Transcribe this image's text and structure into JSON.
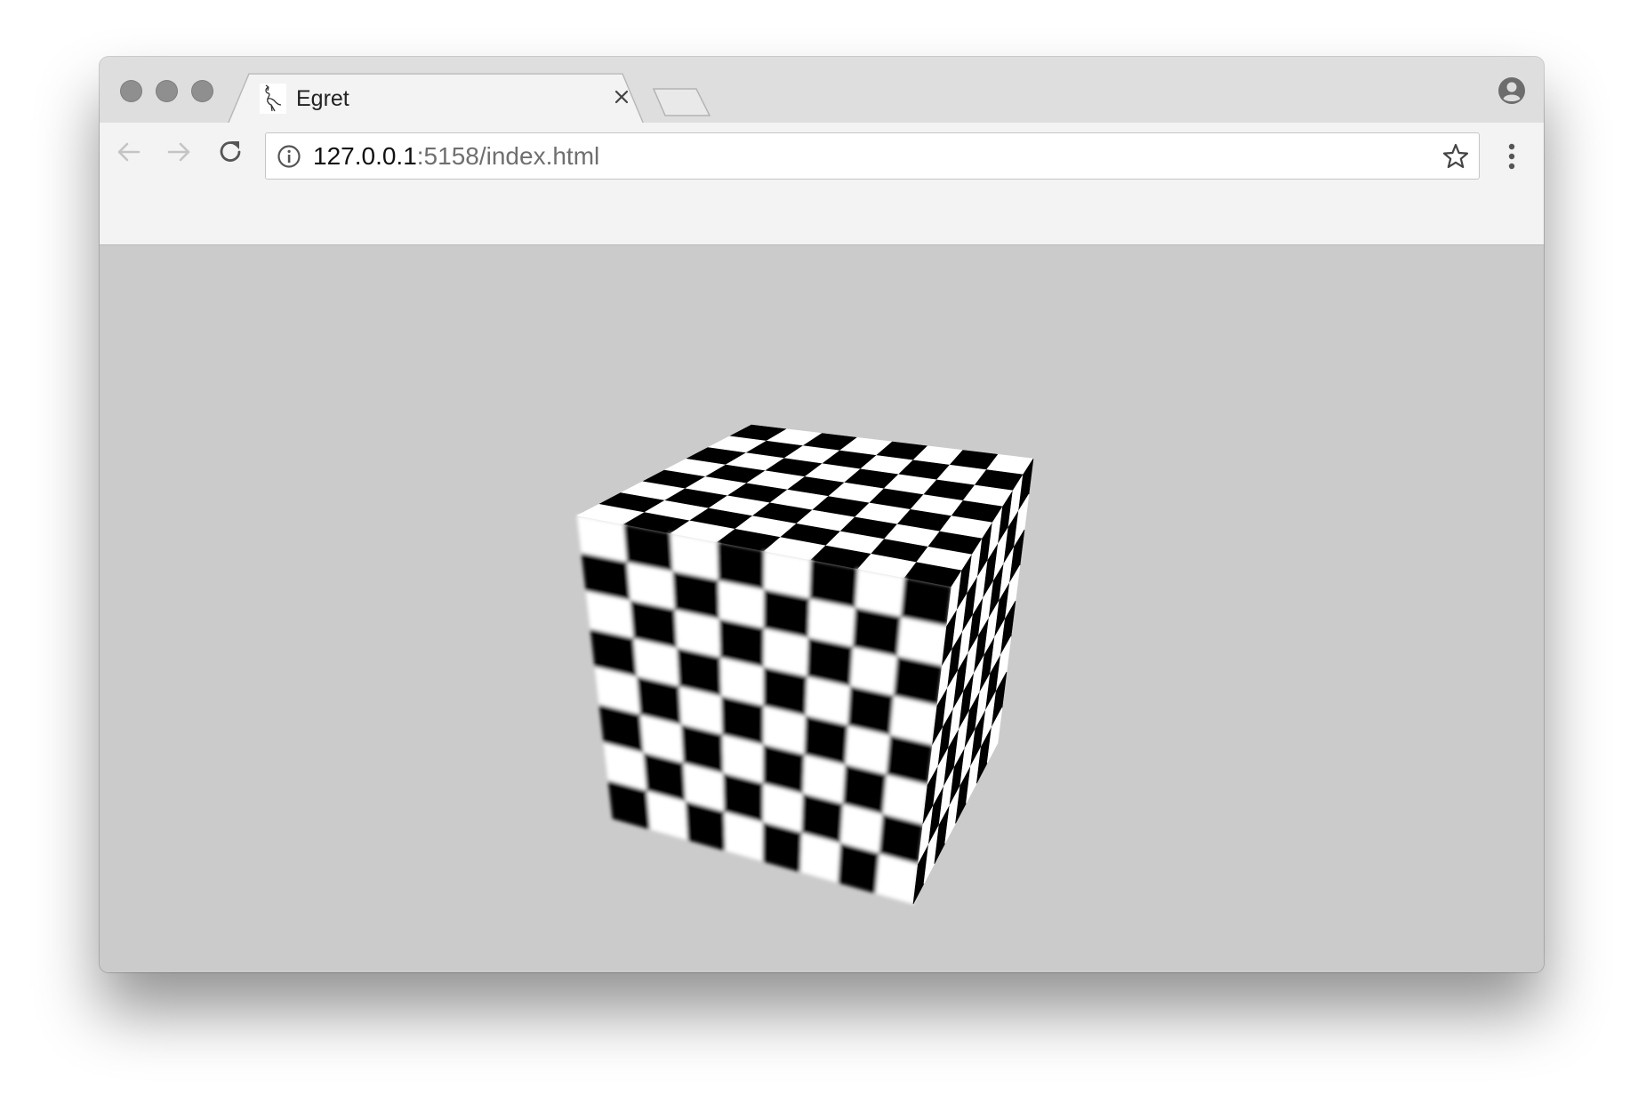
{
  "window": {
    "traffic_lights": [
      "close",
      "minimize",
      "zoom"
    ]
  },
  "tab": {
    "title": "Egret",
    "favicon": "egret-bird-icon",
    "close_icon": "close-icon"
  },
  "toolbar": {
    "back_icon": "back-arrow-icon",
    "forward_icon": "forward-arrow-icon",
    "reload_icon": "reload-icon",
    "menu_icon": "more-vert-icon",
    "profile_icon": "account-icon"
  },
  "address_bar": {
    "security_icon": "info-icon",
    "url_host": "127.0.0.1",
    "url_rest": ":5158/index.html",
    "bookmark_icon": "star-icon"
  },
  "page": {
    "background": "#cbcbcb",
    "scene": {
      "object": "checkerboard-textured-cube",
      "checker_colors": [
        "#000000",
        "#ffffff"
      ]
    }
  }
}
